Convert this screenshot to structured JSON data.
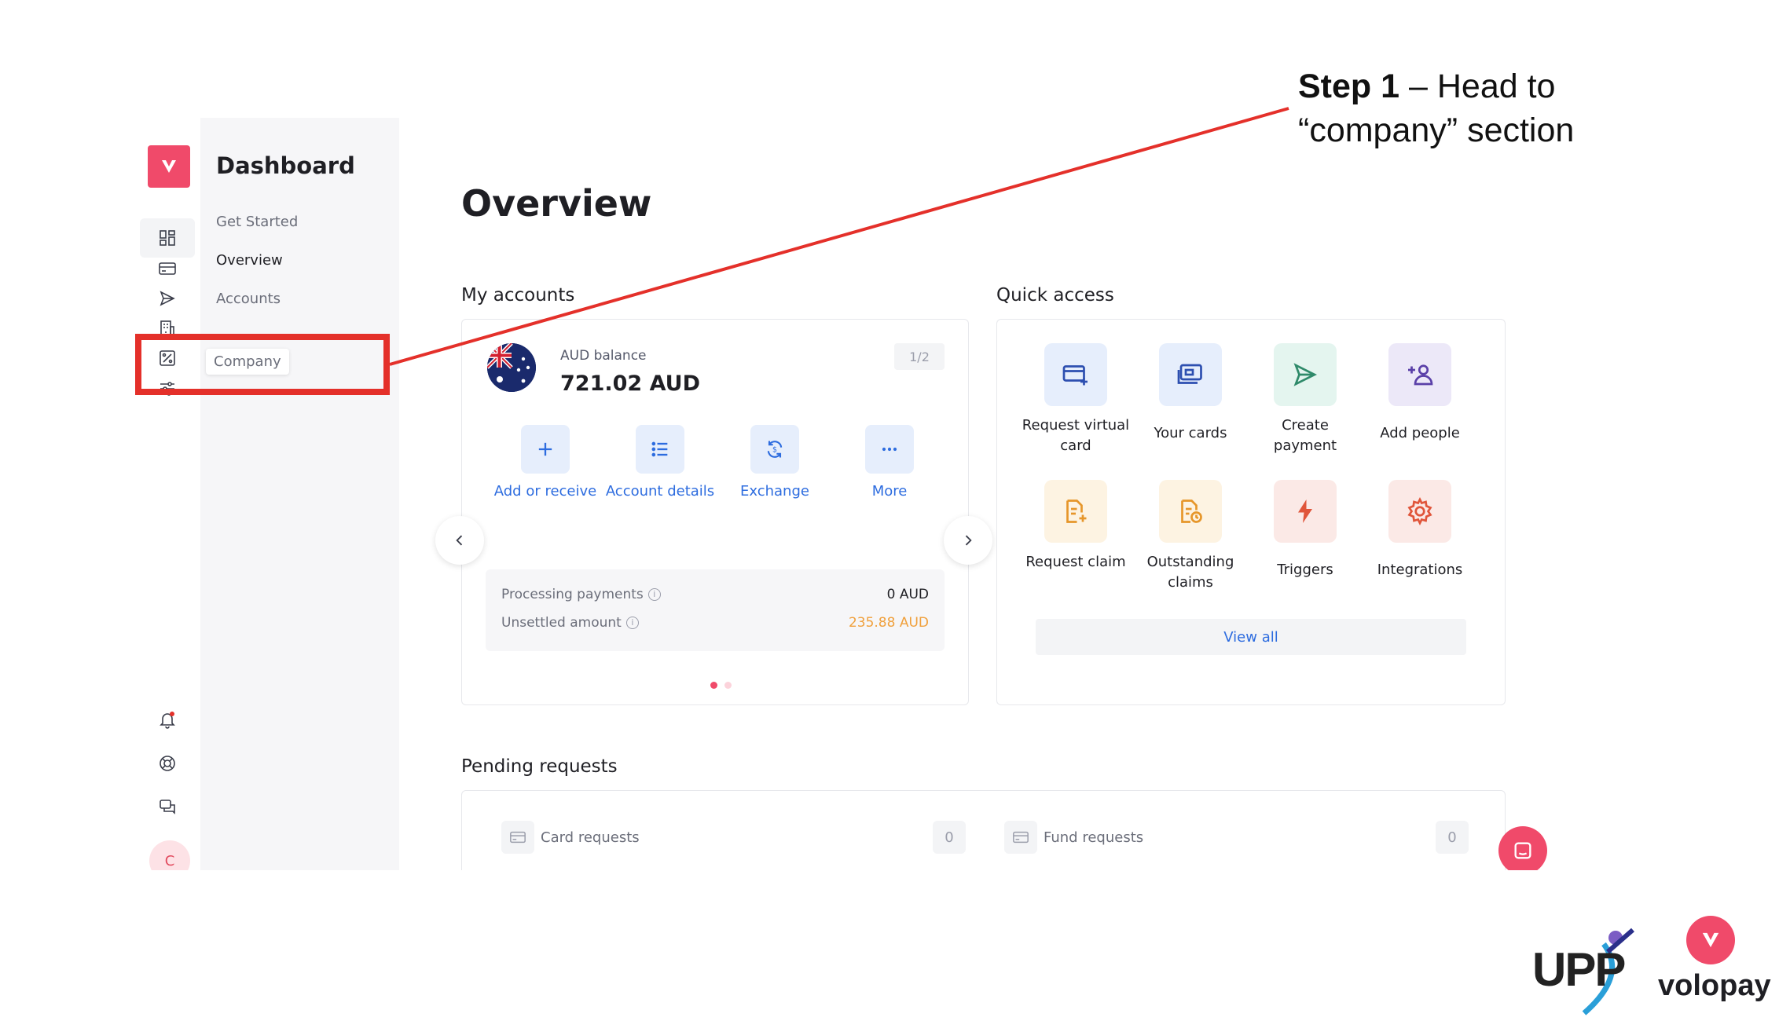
{
  "sidebar": {
    "title": "Dashboard",
    "items": [
      {
        "label": "Get Started"
      },
      {
        "label": "Overview"
      },
      {
        "label": "Accounts"
      }
    ],
    "tooltip": "Company",
    "avatar_initial": "C"
  },
  "main": {
    "title": "Overview",
    "my_accounts": {
      "heading": "My accounts",
      "balance_label": "AUD balance",
      "balance_value": "721.02 AUD",
      "pager": "1/2",
      "actions": [
        {
          "label": "Add or receive"
        },
        {
          "label": "Account details"
        },
        {
          "label": "Exchange"
        },
        {
          "label": "More"
        }
      ],
      "processing_label": "Processing payments",
      "processing_value": "0 AUD",
      "unsettled_label": "Unsettled amount",
      "unsettled_value": "235.88 AUD"
    },
    "quick_access": {
      "heading": "Quick access",
      "items": [
        {
          "label": "Request virtual card"
        },
        {
          "label": "Your cards"
        },
        {
          "label": "Create payment"
        },
        {
          "label": "Add people"
        },
        {
          "label": "Request claim"
        },
        {
          "label": "Outstanding claims"
        },
        {
          "label": "Triggers"
        },
        {
          "label": "Integrations"
        }
      ],
      "view_all": "View all"
    },
    "pending": {
      "heading": "Pending requests",
      "card_requests": "Card requests",
      "card_count": "0",
      "fund_requests": "Fund requests",
      "fund_count": "0"
    }
  },
  "annotation": {
    "step_bold": "Step 1",
    "step_rest": " – Head to",
    "step_line2": "“company” section"
  },
  "branding": {
    "upp": "UPP",
    "volopay": "volopay"
  },
  "colors": {
    "brand": "#f04a6a",
    "annotation_red": "#e4302a",
    "link_blue": "#2d6cdf",
    "warn_orange": "#f0a03c"
  }
}
